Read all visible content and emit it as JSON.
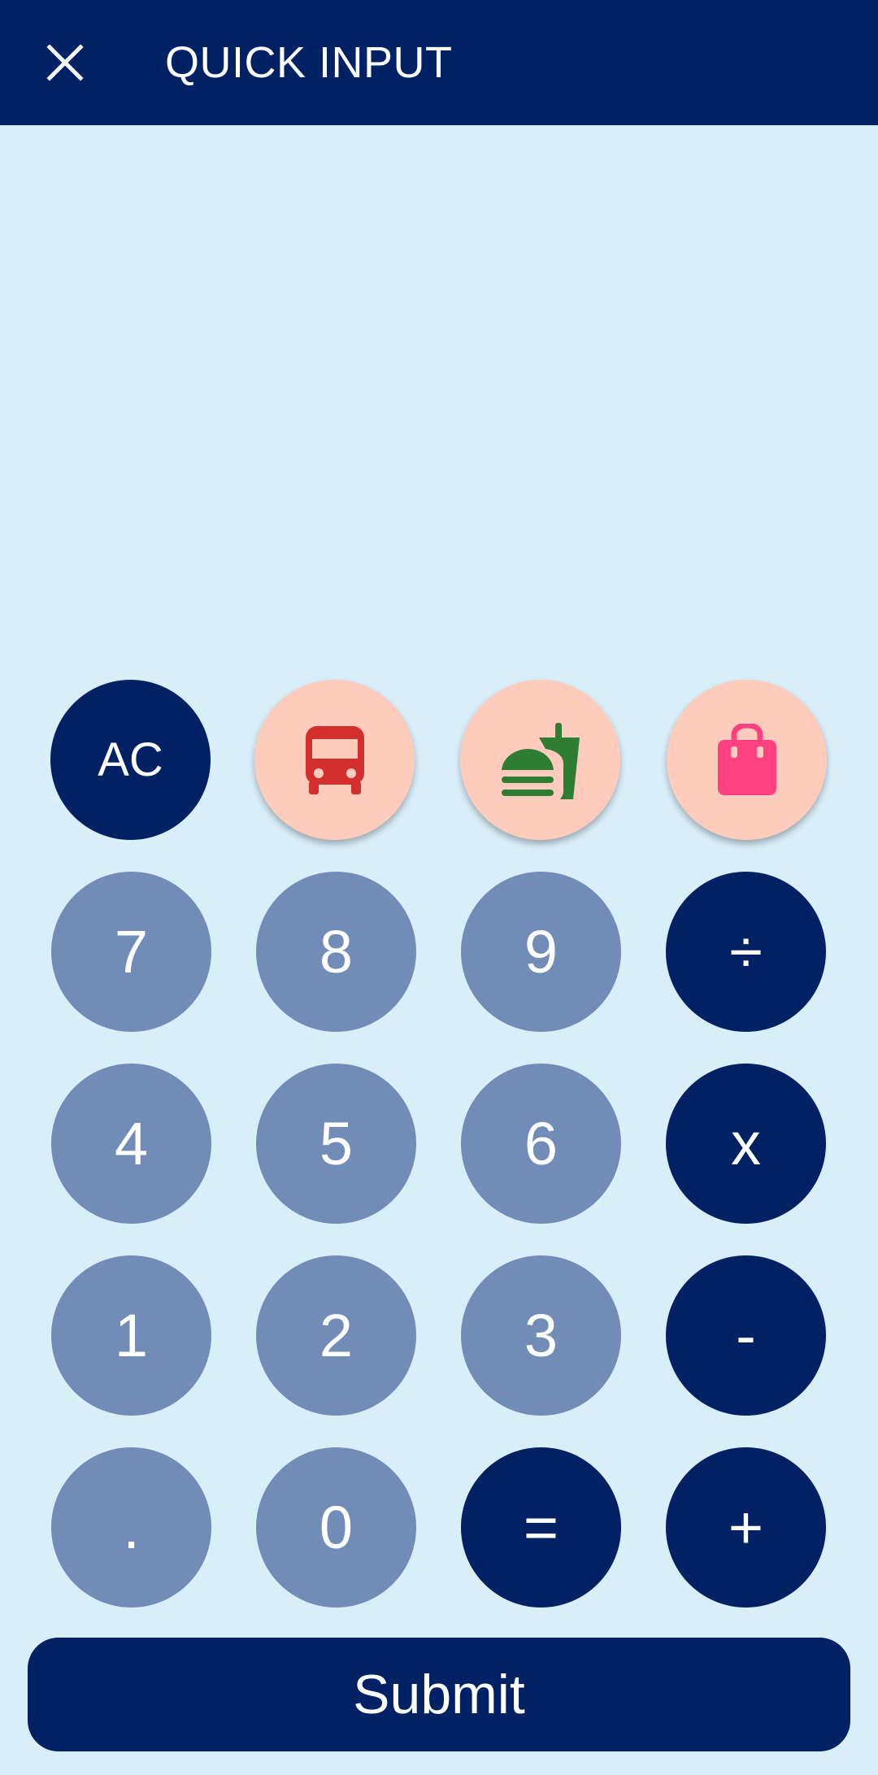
{
  "header": {
    "title": "QUICK INPUT",
    "close_icon": "close-icon"
  },
  "colors": {
    "header_bg": "#002163",
    "page_bg": "#d8eef8",
    "number_key": "#728cb8",
    "operator_key": "#002163",
    "category_key": "#fecbbd",
    "bus_icon": "#d32f2f",
    "food_icon": "#2e7d32",
    "shopping_icon": "#ff4081"
  },
  "keypad": {
    "clear_label": "AC",
    "categories": [
      {
        "name": "transport",
        "icon": "bus-icon"
      },
      {
        "name": "food",
        "icon": "fastfood-icon"
      },
      {
        "name": "shopping",
        "icon": "shopping-bag-icon"
      }
    ],
    "digits": {
      "seven": "7",
      "eight": "8",
      "nine": "9",
      "four": "4",
      "five": "5",
      "six": "6",
      "one": "1",
      "two": "2",
      "three": "3",
      "zero": "0",
      "dot": "."
    },
    "operators": {
      "divide": "÷",
      "multiply": "x",
      "subtract": "-",
      "equals": "=",
      "add": "+"
    }
  },
  "submit_label": "Submit"
}
